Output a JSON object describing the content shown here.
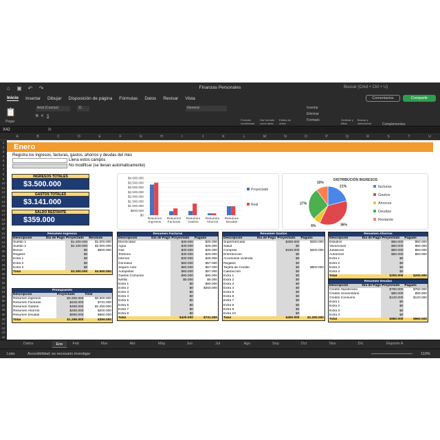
{
  "window": {
    "title": "Finanzas Personales",
    "search": "Buscar (Cmd + Ctrl + U)",
    "comments": "Comentarios",
    "share": "Compartir"
  },
  "menu": [
    "Inicio",
    "Insertar",
    "Dibujar",
    "Disposición de página",
    "Fórmulas",
    "Datos",
    "Revisar",
    "Vista"
  ],
  "ribbon": {
    "paste": "Pegar",
    "font": "Arial (Cuerpo)",
    "size": "11",
    "format": "General",
    "cond": "Formato condicional",
    "table": "Dar formato como tabla",
    "styles": "Estilos de celda",
    "insert": "Insertar",
    "delete": "Eliminar",
    "fmt": "Formato",
    "sort": "Ordenar y filtrar",
    "find": "Buscar y seleccionar",
    "addins": "Complementos"
  },
  "namebox": "X42",
  "fx": "fx",
  "columns": [
    "A",
    "B",
    "C",
    "D",
    "E",
    "F",
    "G",
    "H",
    "I",
    "J",
    "K",
    "L",
    "M",
    "N",
    "O",
    "P",
    "Q",
    "R",
    "S",
    "T",
    "U"
  ],
  "sheet": {
    "title": "Enero",
    "instr": "Registra los ingresos, facturas, gastos, ahorros y deudas del mes",
    "legend1": "Llena estos campos",
    "legend2": "No modificar (se llenan automaticamente)",
    "kpis": [
      {
        "label": "INGRESOS TOTALES",
        "value": "$3.500.000"
      },
      {
        "label": "GASTOS TOTALES",
        "value": "$3.141.000"
      },
      {
        "label": "SALDO RESTANTE",
        "value": "$359.000"
      }
    ]
  },
  "tables": {
    "ingresos": {
      "title": "Resumen Ingresos",
      "headers": [
        "Descripción",
        "Día de Pago",
        "Proyectado",
        "Recibido"
      ],
      "rows": [
        [
          "Sueldo 1",
          "",
          "$1.200.000",
          "$1.000.000"
        ],
        [
          "Sueldo 2",
          "",
          "$2.100.000",
          "$2.000.000"
        ],
        [
          "Bonos",
          "",
          "$0",
          "$500.000"
        ],
        [
          "Regalos",
          "",
          "$0",
          ""
        ],
        [
          "Extra 1",
          "",
          "$0",
          ""
        ],
        [
          "Extra 2",
          "",
          "$0",
          ""
        ],
        [
          "Extra 3",
          "",
          "$0",
          ""
        ]
      ],
      "total": [
        "Total",
        "",
        "$3.300.000",
        "$3.500.000"
      ]
    },
    "facturas": {
      "title": "Resumen Facturas",
      "headers": [
        "Descripción",
        "Día de Pago",
        "Proyectado",
        "Pagado"
      ],
      "rows": [
        [
          "Electricidad",
          "",
          "$30.000",
          "$25.000"
        ],
        [
          "Agua",
          "",
          "$30.000",
          "$25.000"
        ],
        [
          "Gas",
          "",
          "$30.000",
          "$25.000"
        ],
        [
          "Telefono",
          "",
          "$30.000",
          "$25.000"
        ],
        [
          "Internet",
          "",
          "$30.000",
          "$25.000"
        ],
        [
          "Gimnasio",
          "",
          "$60.000",
          "$57.000"
        ],
        [
          "Seguro Auto",
          "",
          "$60.000",
          "$57.000"
        ],
        [
          "Autopistas",
          "",
          "$60.000",
          "$57.000"
        ],
        [
          "Gastos Comunes",
          "",
          "$90.000",
          "$90.000"
        ],
        [
          "Netflix",
          "",
          "$5.000",
          "$5.000"
        ],
        [
          "Extra 1",
          "",
          "$0",
          "$90.000"
        ],
        [
          "Extra 2",
          "",
          "$0",
          "$250.000"
        ],
        [
          "Extra 3",
          "",
          "$0",
          ""
        ],
        [
          "Extra 4",
          "",
          "$0",
          ""
        ],
        [
          "Extra 5",
          "",
          "$0",
          ""
        ],
        [
          "Extra 6",
          "",
          "$0",
          ""
        ],
        [
          "Extra 7",
          "",
          "$0",
          ""
        ],
        [
          "Extra 8",
          "",
          "$0",
          ""
        ]
      ],
      "total": [
        "Total",
        "",
        "$425.000",
        "$731.000"
      ]
    },
    "gastos": {
      "title": "Resumen Gastos",
      "headers": [
        "Descripción",
        "Día de Pago",
        "Proyectado",
        "Pagado"
      ],
      "rows": [
        [
          "Supermercado",
          "",
          "$300.000",
          "$250.000"
        ],
        [
          "Salud",
          "",
          "$0",
          ""
        ],
        [
          "Compras",
          "",
          "$150.000",
          "$200.000"
        ],
        [
          "Entretención",
          "",
          "$0",
          ""
        ],
        [
          "Accesorios vivienda",
          "",
          "$0",
          ""
        ],
        [
          "Regalos",
          "",
          "$0",
          ""
        ],
        [
          "Tarjeta de Credito",
          "",
          "$0",
          "$800.000"
        ],
        [
          "Calefacción",
          "",
          "$0",
          ""
        ],
        [
          "Extra 1",
          "",
          "$0",
          ""
        ],
        [
          "Extra 2",
          "",
          "$0",
          ""
        ],
        [
          "Extra 3",
          "",
          "$0",
          ""
        ],
        [
          "Extra 4",
          "",
          "$0",
          ""
        ],
        [
          "Extra 5",
          "",
          "$0",
          ""
        ],
        [
          "Extra 6",
          "",
          "$0",
          ""
        ],
        [
          "Extra 7",
          "",
          "$0",
          ""
        ],
        [
          "Extra 8",
          "",
          "$0",
          ""
        ],
        [
          "Extra 9",
          "",
          "$0",
          ""
        ],
        [
          "Extra 10",
          "",
          "$0",
          ""
        ]
      ],
      "total": [
        "Total",
        "",
        "$450.000",
        "$1.250.000"
      ]
    },
    "ahorros": {
      "title": "Resumen Ahorros",
      "headers": [
        "Descripción",
        "Día de Pago",
        "Proyectado",
        "Pagado"
      ],
      "rows": [
        [
          "Estudios",
          "",
          "$50.000",
          "$50.000"
        ],
        [
          "Vacaciones",
          "",
          "$50.000",
          "$50.000"
        ],
        [
          "Jubilación",
          "",
          "$50.000",
          "$50.000"
        ],
        [
          "Automovil",
          "",
          "$50.000",
          "$50.000"
        ],
        [
          "Extra 1",
          "",
          "$0",
          ""
        ],
        [
          "Extra 2",
          "",
          "$0",
          ""
        ],
        [
          "Extra 3",
          "",
          "$0",
          ""
        ],
        [
          "Extra 4",
          "",
          "$0",
          ""
        ]
      ],
      "total": [
        "Total",
        "",
        "$200.000",
        "$200.000"
      ]
    },
    "deudas": {
      "title": "Resumen Deudas",
      "headers": [
        "Descripción",
        "Día de Pago",
        "Proyectado",
        "Pagado"
      ],
      "rows": [
        [
          "Credito Hipotecario",
          "",
          "$750.000",
          "$750.000"
        ],
        [
          "Credito Universitario",
          "",
          "$90.000",
          "$90.000"
        ],
        [
          "Credito Consumo",
          "",
          "$120.000",
          "$120.000"
        ],
        [
          "Extra 1",
          "",
          "$0",
          ""
        ],
        [
          "Extra 2",
          "",
          "$0",
          ""
        ],
        [
          "Extra 3",
          "",
          "$0",
          ""
        ],
        [
          "Extra 4",
          "",
          "$0",
          ""
        ]
      ],
      "total": [
        "Total",
        "",
        "$960.000",
        "$960.000"
      ]
    },
    "presupuesto": {
      "title": "Presupuesto",
      "headers": [
        "Descripción",
        "Proyectado",
        "Total"
      ],
      "rows": [
        [
          "Resumen Ingresos",
          "$3.300.000",
          "$3.500.000"
        ],
        [
          "Resumen Facturas",
          "$425.000",
          "$731.000"
        ],
        [
          "Resumen Gastos",
          "$450.000",
          "$1.250.000"
        ],
        [
          "Resumen Ahorros",
          "$200.000",
          "$200.000"
        ],
        [
          "Resumen Deudas",
          "$960.000",
          "$960.000"
        ]
      ],
      "total": [
        "Total",
        "$1.265.000",
        "$359.000"
      ]
    }
  },
  "chart_data": [
    {
      "type": "bar",
      "categories": [
        "Resumen Ingresos",
        "Resumen Facturas",
        "Resumen Gastos",
        "Resumen Ahorros",
        "Resumen Deudas"
      ],
      "series": [
        {
          "name": "Proyectado",
          "values": [
            3300000,
            425000,
            450000,
            200000,
            960000
          ],
          "color": "#4472c4"
        },
        {
          "name": "Real",
          "values": [
            3500000,
            731000,
            1250000,
            200000,
            960000
          ],
          "color": "#e0474c"
        }
      ],
      "yticks": [
        "$4.000.000",
        "$3.500.000",
        "$3.000.000",
        "$2.500.000",
        "$2.000.000",
        "$1.500.000",
        "$1.000.000",
        "$500.000",
        "$0"
      ],
      "ylim": [
        0,
        4000000
      ],
      "legend": "right"
    },
    {
      "type": "pie",
      "title": "DISTRIBUCIÓN INGRESOS",
      "labels": [
        "facturas",
        "Gastos",
        "Ahorros",
        "Deudas",
        "Restante"
      ],
      "values": [
        21,
        36,
        6,
        27,
        10
      ],
      "pct_labels": [
        "21%",
        "36%",
        "6%",
        "27%",
        "10%"
      ],
      "colors": [
        "#4a86e8",
        "#e0474c",
        "#f4c430",
        "#4caf50",
        "#ff7f50"
      ],
      "legend": "right"
    }
  ],
  "tabs": [
    "Datos",
    "Ene",
    "Feb",
    "Mar",
    "Abr",
    "May",
    "Jun",
    "Jul",
    "Ago",
    "Sep",
    "Oct",
    "Nov",
    "Dic",
    "Reporte A"
  ],
  "status": {
    "ready": "Listo",
    "access": "Accesibilidad: es necesario investigar",
    "zoom": "110%"
  }
}
